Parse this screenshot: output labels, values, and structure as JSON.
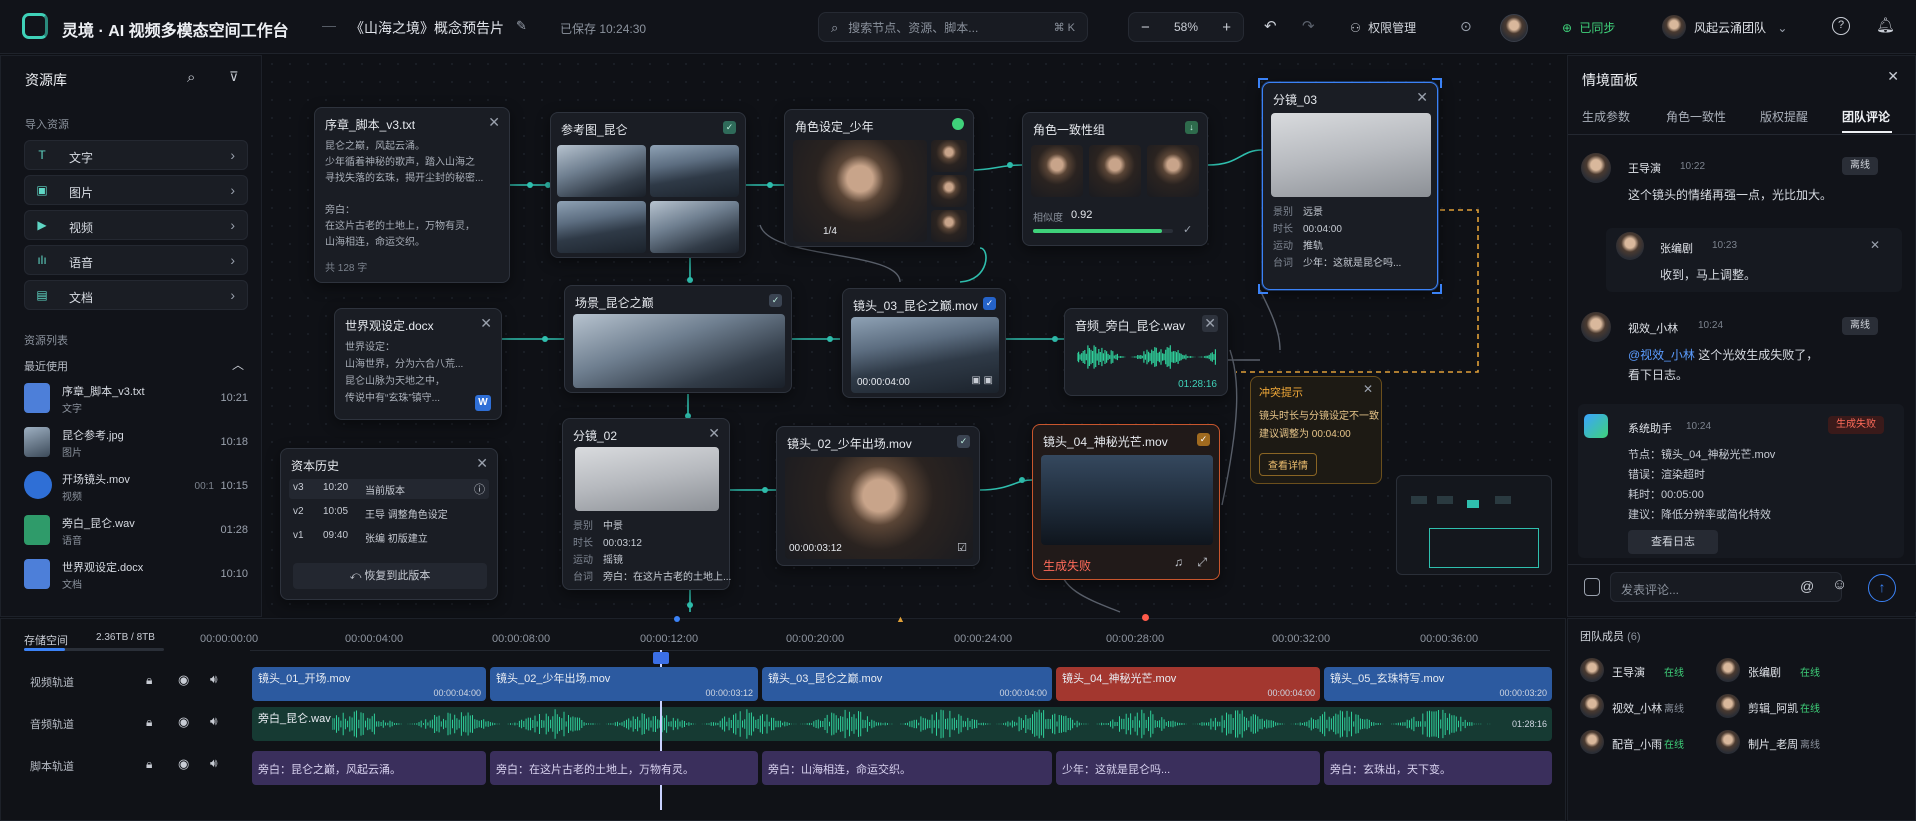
{
  "header": {
    "app_title": "灵境 · AI 视频多模态空间工作台",
    "dash": "—",
    "project_title": "《山海之境》概念预告片",
    "saved_status": "已保存 10:24:30",
    "search_placeholder": "搜索节点、资源、脚本...",
    "search_shortcut": "⌘ K",
    "zoom_minus": "−",
    "zoom_level": "58%",
    "zoom_plus": "+",
    "permission_label": "权限管理",
    "sync_label": "已同步",
    "team_name": "风起云涌团队",
    "help": "?",
    "colors": {
      "accent": "#3fd1b8",
      "sync": "#3fd17a"
    }
  },
  "sidebar": {
    "title": "资源库",
    "import_title": "导入资源",
    "import_items": [
      {
        "icon": "T",
        "label": "文字"
      },
      {
        "icon": "▣",
        "label": "图片"
      },
      {
        "icon": "▶",
        "label": "视频"
      },
      {
        "icon": "ılı",
        "label": "语音"
      },
      {
        "icon": "▤",
        "label": "文档"
      }
    ],
    "list_title": "资源列表",
    "recent_title": "最近使用",
    "resources": [
      {
        "name": "序章_脚本_v3.txt",
        "type": "文字",
        "time": "10:21"
      },
      {
        "name": "昆仑参考.jpg",
        "type": "图片",
        "time": "10:18"
      },
      {
        "name": "开场镜头.mov",
        "type": "视频",
        "time": "10:15",
        "dur": "00:1"
      },
      {
        "name": "旁白_昆仑.wav",
        "type": "语音",
        "time": "01:28",
        "tag": "01:28"
      },
      {
        "name": "世界观设定.docx",
        "type": "文档",
        "time": "10:10"
      }
    ]
  },
  "canvas": {
    "script_node": {
      "title": "序章_脚本_v3.txt",
      "lines": [
        "昆仑之巅，风起云涌。",
        "少年循着神秘的歌声，踏入山海之",
        "寻找失落的玄珠，揭开尘封的秘密...",
        "",
        "旁白：",
        "在这片古老的土地上，万物有灵，",
        "山海相连，命运交织。"
      ],
      "count": "共 128 字"
    },
    "ref_node": {
      "title": "参考图_昆仑"
    },
    "role_node": {
      "title": "角色设定_少年",
      "badge": "1/4"
    },
    "consistency_node": {
      "title": "角色一致性组",
      "sim_label": "相似度",
      "sim_value": "0.92",
      "sim_fill": 0.92
    },
    "shot03_node": {
      "title": "分镜_03",
      "meta": [
        {
          "k": "景别",
          "v": "远景"
        },
        {
          "k": "时长",
          "v": "00:04:00"
        },
        {
          "k": "运动",
          "v": "推轨"
        },
        {
          "k": "台词",
          "v": "少年：这就是昆仑吗..."
        }
      ]
    },
    "world_node": {
      "title": "世界观设定.docx",
      "lines": [
        "世界设定：",
        "山海世界，分为六合八荒...",
        "昆仑山脉为天地之中，",
        "传说中有“玄珠”镇守..."
      ],
      "badge": "W"
    },
    "scene_node": {
      "title": "场景_昆仑之巅"
    },
    "shot03v_node": {
      "title": "镜头_03_昆仑之巅.mov",
      "time": "00:00:04:00"
    },
    "audio_node": {
      "title": "音频_旁白_昆仑.wav",
      "time": "01:28:16"
    },
    "conflict": {
      "title": "冲突提示",
      "lines": [
        "镜头时长与分镜设定不一致",
        "建议调整为 00:04:00"
      ],
      "button": "查看详情"
    },
    "history": {
      "title": "资本历史",
      "rows": [
        {
          "ver": "v3",
          "time": "10:20",
          "text": "当前版本"
        },
        {
          "ver": "v2",
          "time": "10:05",
          "text": "王导 调整角色设定"
        },
        {
          "ver": "v1",
          "time": "09:40",
          "text": "张编 初版建立"
        }
      ],
      "button": "恢复到此版本"
    },
    "shot02_node": {
      "title": "分镜_02",
      "meta": [
        {
          "k": "景别",
          "v": "中景"
        },
        {
          "k": "时长",
          "v": "00:03:12"
        },
        {
          "k": "运动",
          "v": "摇镜"
        },
        {
          "k": "台词",
          "v": "旁白：在这片古老的土地上..."
        }
      ]
    },
    "shot02v_node": {
      "title": "镜头_02_少年出场.mov",
      "time": "00:00:03:12"
    },
    "shot04v_node": {
      "title": "镜头_04_神秘光芒.mov",
      "fail": "生成失败"
    }
  },
  "right": {
    "title": "情境面板",
    "tabs": [
      "生成参数",
      "角色一致性",
      "版权提醒",
      "团队评论"
    ],
    "comments": [
      {
        "name": "王导演",
        "time": "10:22",
        "badge": "离线",
        "text": "这个镜头的情绪再强一点，光比加大。"
      },
      {
        "name": "张编剧",
        "time": "10:23",
        "text": "收到，马上调整。"
      },
      {
        "name": "视效_小林",
        "time": "10:24",
        "badge": "离线",
        "mention": "@视效_小林",
        "text": " 这个光效生成失败了，",
        "text2": "看下日志。"
      },
      {
        "name": "系统助手",
        "time": "10:24",
        "badge": "生成失败",
        "lines": [
          "节点：镜头_04_神秘光芒.mov",
          "错误：渲染超时",
          "耗时：00:05:00",
          "建议：降低分辨率或简化特效"
        ],
        "button": "查看日志"
      }
    ],
    "comment_placeholder": "发表评论...",
    "team_title": "团队成员",
    "team_count": "(6)",
    "members": [
      {
        "name": "王导演",
        "status": "在线"
      },
      {
        "name": "张编剧",
        "status": "在线"
      },
      {
        "name": "视效_小林",
        "status": "离线"
      },
      {
        "name": "剪辑_阿凯",
        "status": "在线"
      },
      {
        "name": "配音_小雨",
        "status": "在线"
      },
      {
        "name": "制片_老周",
        "status": "离线"
      }
    ]
  },
  "timeline": {
    "storage_label": "存储空间",
    "storage_value": "2.36TB / 8TB",
    "storage_fill": 0.295,
    "ticks": [
      "00:00:00:00",
      "00:00:04:00",
      "00:00:08:00",
      "00:00:12:00",
      "00:00:20:00",
      "00:00:24:00",
      "00:00:28:00",
      "00:00:32:00",
      "00:00:36:00"
    ],
    "tracks": [
      "视频轨道",
      "音频轨道",
      "脚本轨道"
    ],
    "video_clips": [
      {
        "label": "镜头_01_开场.mov",
        "dur": "00:00:04:00"
      },
      {
        "label": "镜头_02_少年出场.mov",
        "dur": "00:00:03:12"
      },
      {
        "label": "镜头_03_昆仑之巅.mov",
        "dur": "00:00:04:00"
      },
      {
        "label": "镜头_04_神秘光芒.mov",
        "dur": "00:00:04:00"
      },
      {
        "label": "镜头_05_玄珠特写.mov",
        "dur": "00:00:03:20"
      }
    ],
    "audio_clip": {
      "label": "旁白_昆仑.wav",
      "dur": "01:28:16"
    },
    "script_clips": [
      "旁白：昆仑之巅，风起云涌。",
      "旁白：在这片古老的土地上，万物有灵。",
      "旁白：山海相连，命运交织。",
      "少年：这就是昆仑吗...",
      "旁白：玄珠出，天下变。"
    ]
  }
}
